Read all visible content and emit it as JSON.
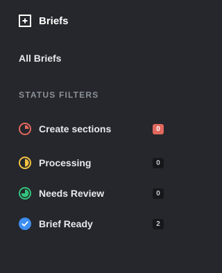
{
  "header": {
    "title": "Briefs",
    "icon": "brief-plus-icon"
  },
  "nav": {
    "all_briefs": "All Briefs"
  },
  "status_filters": {
    "heading": "STATUS FILTERS",
    "items": [
      {
        "label": "Create sections",
        "count": "0",
        "icon": "pie-quarter-icon",
        "color": "#e2685e"
      },
      {
        "label": "Processing",
        "count": "0",
        "icon": "half-circle-icon",
        "color": "#f5c242"
      },
      {
        "label": "Needs Review",
        "count": "0",
        "icon": "pie-three-quarter-icon",
        "color": "#32c47c"
      },
      {
        "label": "Brief Ready",
        "count": "2",
        "icon": "check-circle-icon",
        "color": "#3d8ef0"
      }
    ]
  },
  "colors": {
    "background": "#25272c",
    "badge_alert": "#e2685e",
    "badge_default": "#15171a"
  }
}
